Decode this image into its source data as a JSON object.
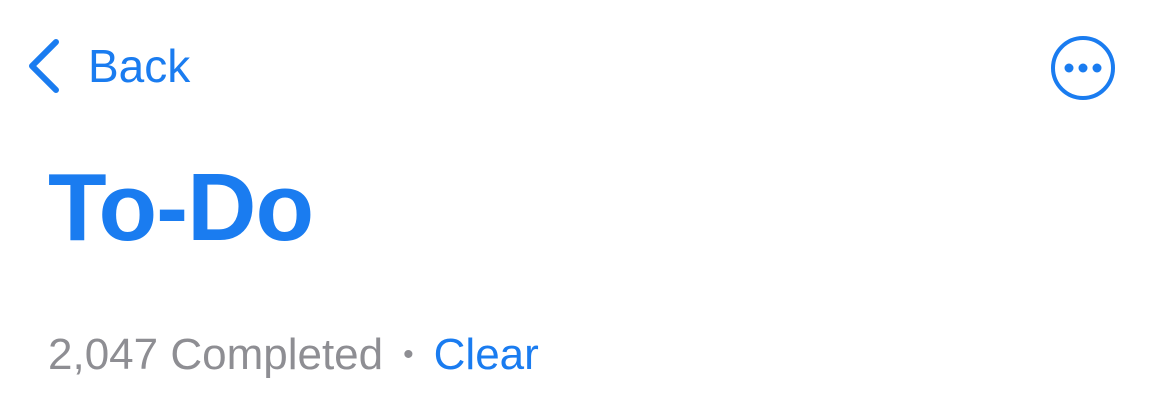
{
  "nav": {
    "back_label": "Back",
    "back_icon": "chevron-left-icon",
    "more_icon": "ellipsis-circle-icon"
  },
  "title": "To-Do",
  "completed": {
    "count_text": "2,047 Completed",
    "separator": "•",
    "clear_label": "Clear"
  },
  "colors": {
    "accent": "#1a7cf0",
    "secondary_text": "#8e8e93",
    "background": "#ffffff"
  }
}
